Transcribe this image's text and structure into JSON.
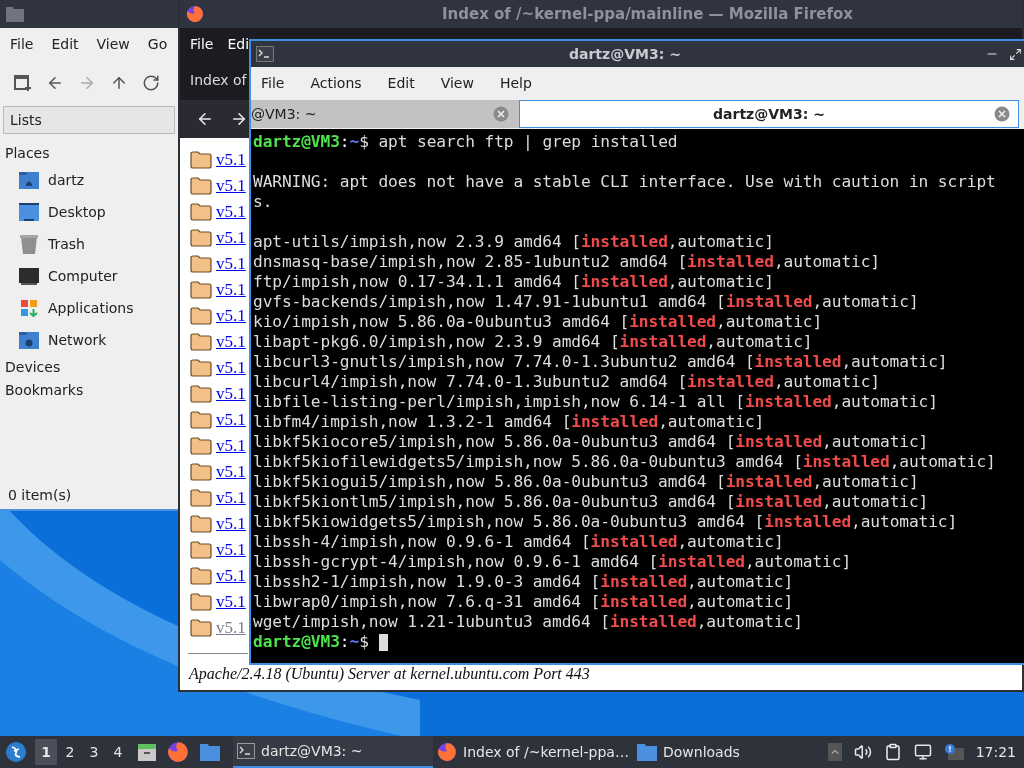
{
  "file_manager": {
    "menu": [
      "File",
      "Edit",
      "View",
      "Go"
    ],
    "location": "Lists",
    "places_title": "Places",
    "places": [
      {
        "label": "dartz",
        "kind": "home"
      },
      {
        "label": "Desktop",
        "kind": "desktop"
      },
      {
        "label": "Trash",
        "kind": "trash"
      },
      {
        "label": "Computer",
        "kind": "computer"
      },
      {
        "label": "Applications",
        "kind": "apps"
      },
      {
        "label": "Network",
        "kind": "network"
      }
    ],
    "sections": [
      "Devices",
      "Bookmarks"
    ],
    "status": "0 item(s)"
  },
  "browser": {
    "title": "Index of /~kernel-ppa/mainline — Mozilla Firefox",
    "menu": [
      "File",
      "Edi"
    ],
    "tab": "Index of",
    "rows": [
      {
        "label": "v5.1",
        "visited": false
      },
      {
        "label": "v5.1",
        "visited": false
      },
      {
        "label": "v5.1",
        "visited": false
      },
      {
        "label": "v5.1",
        "visited": false
      },
      {
        "label": "v5.1",
        "visited": false
      },
      {
        "label": "v5.1",
        "visited": false
      },
      {
        "label": "v5.1",
        "visited": false
      },
      {
        "label": "v5.1",
        "visited": false
      },
      {
        "label": "v5.1",
        "visited": false
      },
      {
        "label": "v5.1",
        "visited": false
      },
      {
        "label": "v5.1",
        "visited": false
      },
      {
        "label": "v5.1",
        "visited": false
      },
      {
        "label": "v5.1",
        "visited": false
      },
      {
        "label": "v5.1",
        "visited": false
      },
      {
        "label": "v5.1",
        "visited": false
      },
      {
        "label": "v5.1",
        "visited": false
      },
      {
        "label": "v5.1",
        "visited": false
      },
      {
        "label": "v5.1",
        "visited": false
      },
      {
        "label": "v5.1",
        "visited": true
      }
    ],
    "footer": "Apache/2.4.18 (Ubuntu) Server at kernel.ubuntu.com Port 443"
  },
  "terminal": {
    "title": "dartz@VM3: ~",
    "menu": [
      "File",
      "Actions",
      "Edit",
      "View",
      "Help"
    ],
    "tabs": [
      {
        "label": "@VM3: ~",
        "selected": false
      },
      {
        "label": "dartz@VM3: ~",
        "selected": true
      }
    ],
    "lines": [
      {
        "kind": "prompt",
        "user": "dartz@VM3",
        "sep": ":",
        "path": "~",
        "symbol": "$",
        "command": " apt search ftp | grep installed",
        "cursor": false
      },
      {
        "kind": "blank"
      },
      {
        "kind": "text",
        "text": "WARNING: apt does not have a stable CLI interface. Use with caution in script"
      },
      {
        "kind": "text",
        "text": "s."
      },
      {
        "kind": "blank"
      },
      {
        "kind": "match",
        "before": "apt-utils/impish,now 2.3.9 amd64 [",
        "match": "installed",
        "after": ",automatic]"
      },
      {
        "kind": "match",
        "before": "dnsmasq-base/impish,now 2.85-1ubuntu2 amd64 [",
        "match": "installed",
        "after": ",automatic]"
      },
      {
        "kind": "match",
        "before": "ftp/impish,now 0.17-34.1.1 amd64 [",
        "match": "installed",
        "after": ",automatic]"
      },
      {
        "kind": "match",
        "before": "gvfs-backends/impish,now 1.47.91-1ubuntu1 amd64 [",
        "match": "installed",
        "after": ",automatic]"
      },
      {
        "kind": "match",
        "before": "kio/impish,now 5.86.0a-0ubuntu3 amd64 [",
        "match": "installed",
        "after": ",automatic]"
      },
      {
        "kind": "match",
        "before": "libapt-pkg6.0/impish,now 2.3.9 amd64 [",
        "match": "installed",
        "after": ",automatic]"
      },
      {
        "kind": "match",
        "before": "libcurl3-gnutls/impish,now 7.74.0-1.3ubuntu2 amd64 [",
        "match": "installed",
        "after": ",automatic]"
      },
      {
        "kind": "match",
        "before": "libcurl4/impish,now 7.74.0-1.3ubuntu2 amd64 [",
        "match": "installed",
        "after": ",automatic]"
      },
      {
        "kind": "match",
        "before": "libfile-listing-perl/impish,impish,now 6.14-1 all [",
        "match": "installed",
        "after": ",automatic]"
      },
      {
        "kind": "match",
        "before": "libfm4/impish,now 1.3.2-1 amd64 [",
        "match": "installed",
        "after": ",automatic]"
      },
      {
        "kind": "match",
        "before": "libkf5kiocore5/impish,now 5.86.0a-0ubuntu3 amd64 [",
        "match": "installed",
        "after": ",automatic]"
      },
      {
        "kind": "match",
        "before": "libkf5kiofilewidgets5/impish,now 5.86.0a-0ubuntu3 amd64 [",
        "match": "installed",
        "after": ",automatic]"
      },
      {
        "kind": "match",
        "before": "libkf5kiogui5/impish,now 5.86.0a-0ubuntu3 amd64 [",
        "match": "installed",
        "after": ",automatic]"
      },
      {
        "kind": "match",
        "before": "libkf5kiontlm5/impish,now 5.86.0a-0ubuntu3 amd64 [",
        "match": "installed",
        "after": ",automatic]"
      },
      {
        "kind": "match",
        "before": "libkf5kiowidgets5/impish,now 5.86.0a-0ubuntu3 amd64 [",
        "match": "installed",
        "after": ",automatic]"
      },
      {
        "kind": "match",
        "before": "libssh-4/impish,now 0.9.6-1 amd64 [",
        "match": "installed",
        "after": ",automatic]"
      },
      {
        "kind": "match",
        "before": "libssh-gcrypt-4/impish,now 0.9.6-1 amd64 [",
        "match": "installed",
        "after": ",automatic]"
      },
      {
        "kind": "match",
        "before": "libssh2-1/impish,now 1.9.0-3 amd64 [",
        "match": "installed",
        "after": ",automatic]"
      },
      {
        "kind": "match",
        "before": "libwrap0/impish,now 7.6.q-31 amd64 [",
        "match": "installed",
        "after": ",automatic]"
      },
      {
        "kind": "match",
        "before": "wget/impish,now 1.21-1ubuntu3 amd64 [",
        "match": "installed",
        "after": ",automatic]"
      },
      {
        "kind": "prompt",
        "user": "dartz@VM3",
        "sep": ":",
        "path": "~",
        "symbol": "$",
        "cursor": true
      }
    ]
  },
  "taskbar": {
    "workspaces": [
      {
        "label": "1",
        "selected": true
      },
      {
        "label": "2",
        "selected": false
      },
      {
        "label": "3",
        "selected": false
      },
      {
        "label": "4",
        "selected": false
      }
    ],
    "tasks": [
      {
        "label": "dartz@VM3: ~",
        "selected": true,
        "kind": "terminal"
      },
      {
        "label": "Index of /~kernel-ppa…",
        "selected": false,
        "kind": "browser"
      },
      {
        "label": "Downloads",
        "selected": false,
        "kind": "folder"
      }
    ],
    "clock": "17:21"
  }
}
